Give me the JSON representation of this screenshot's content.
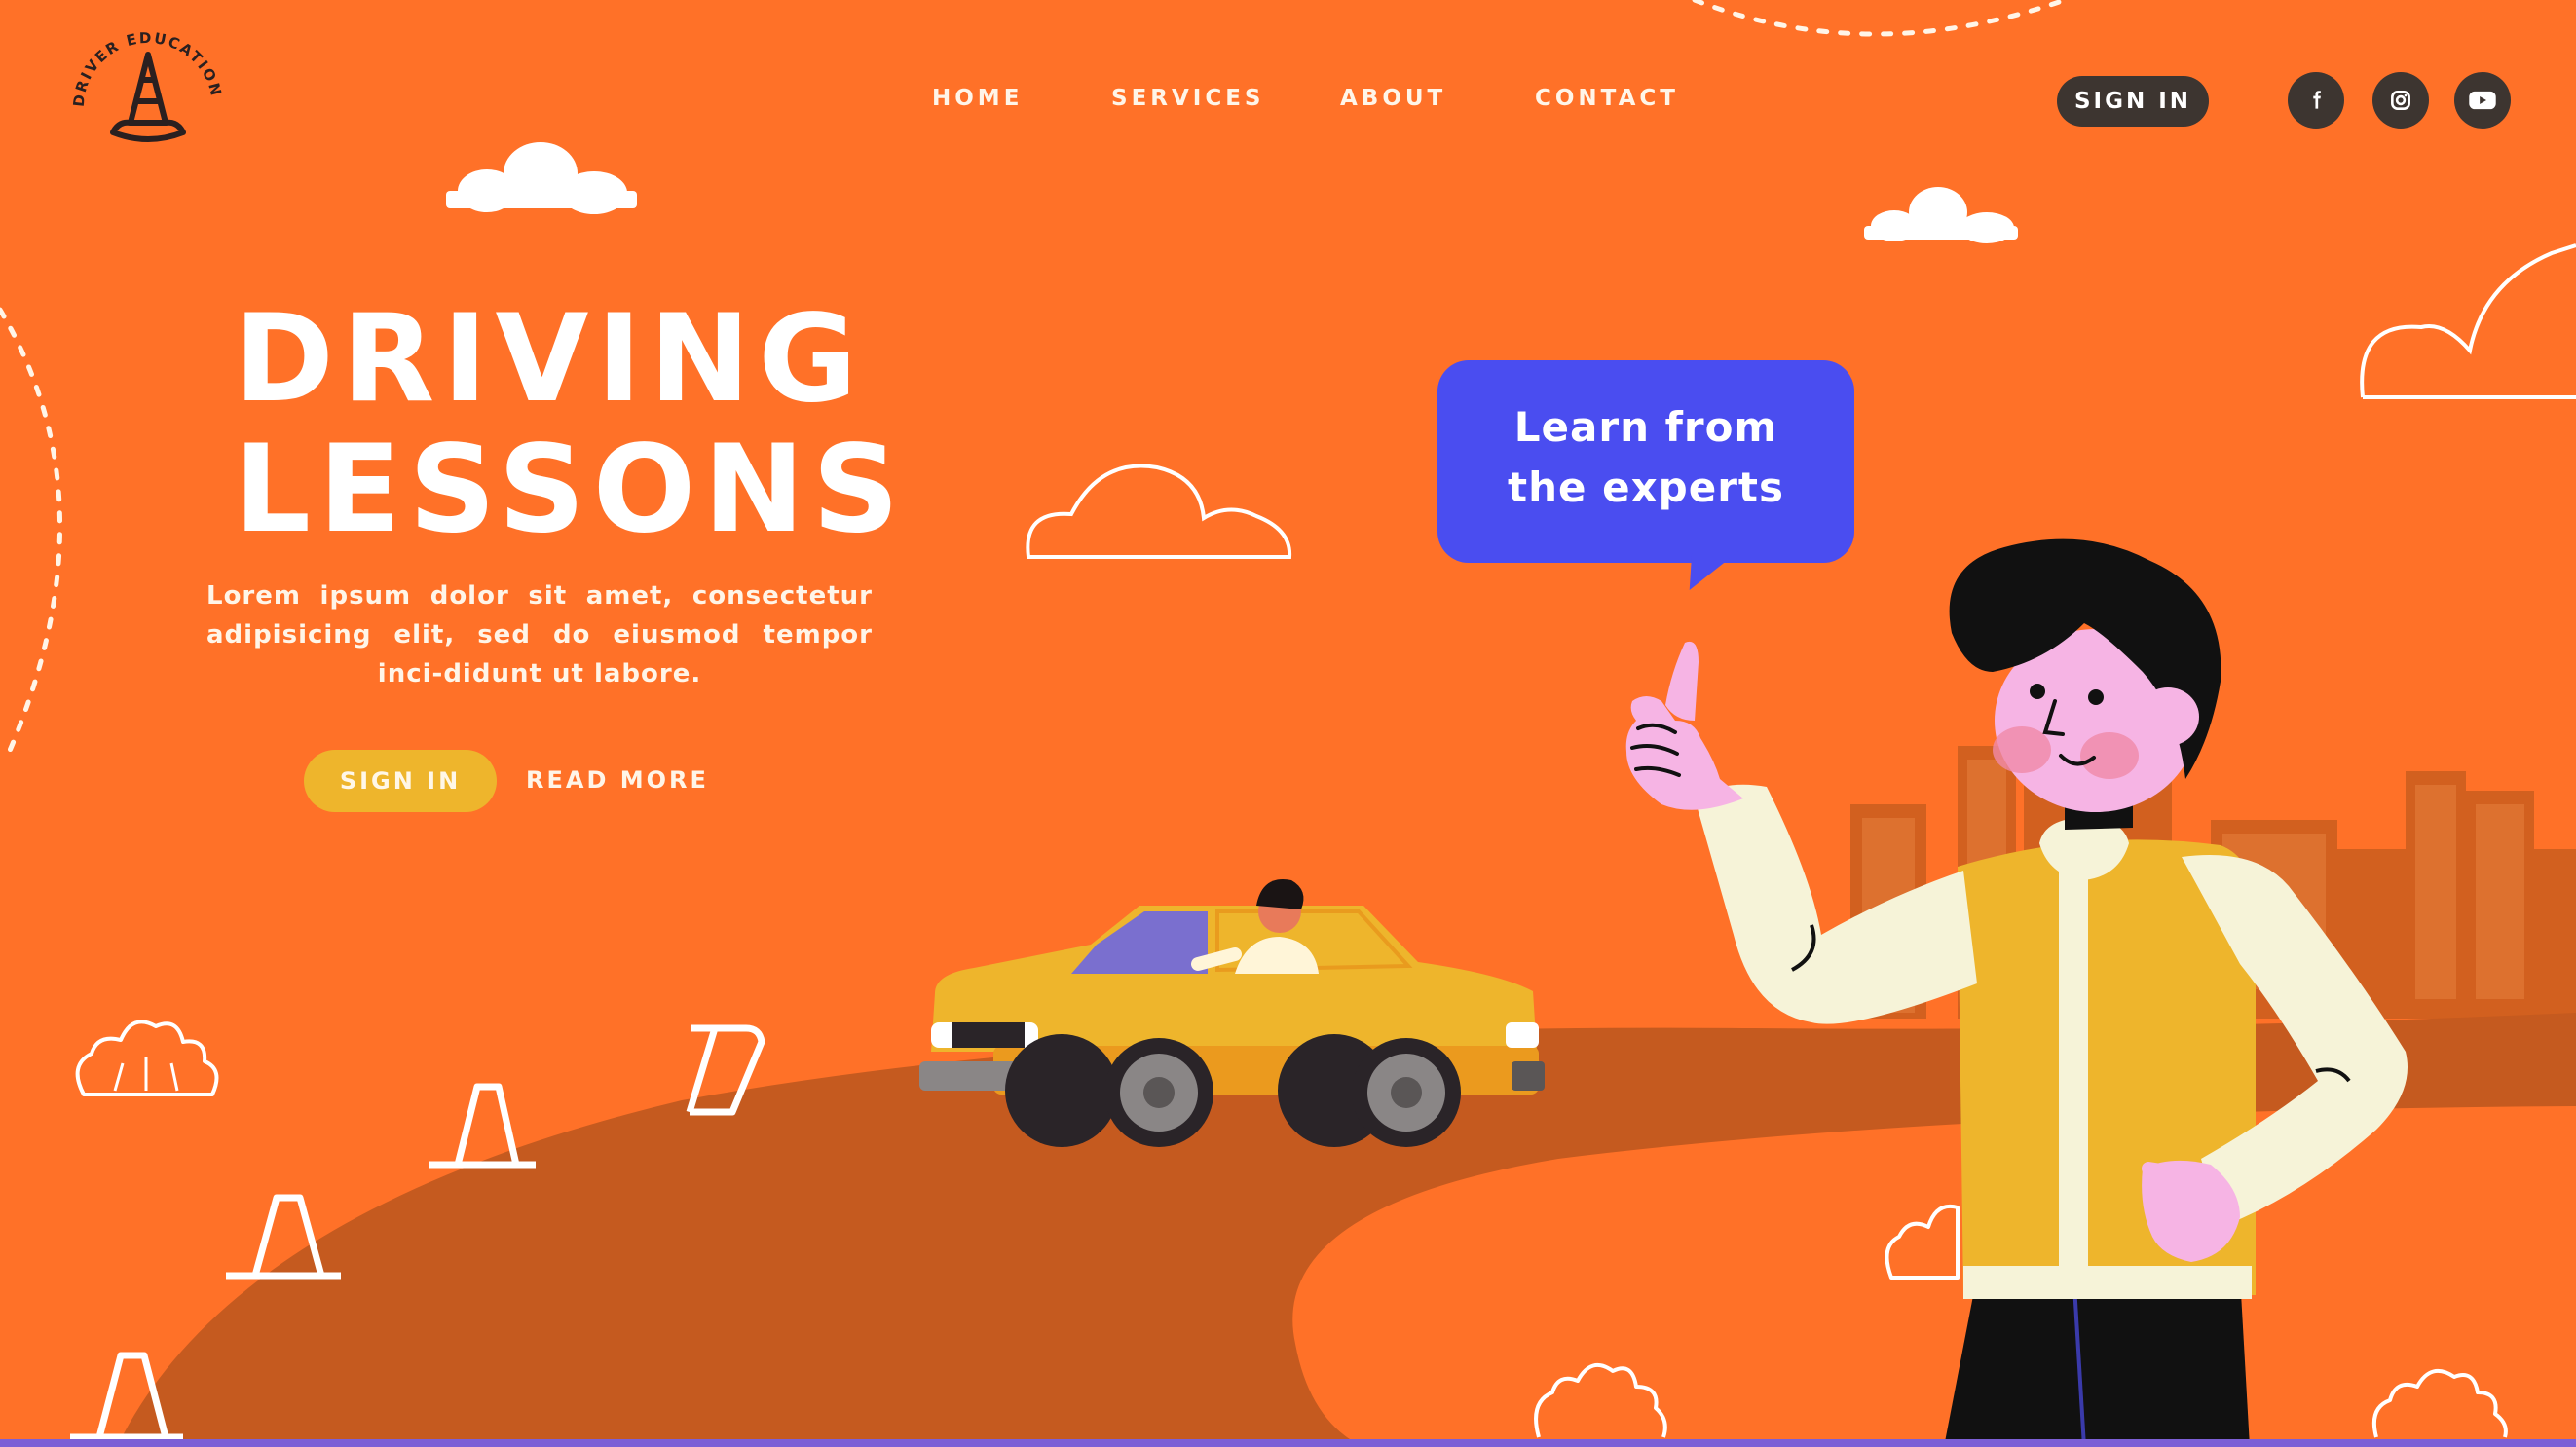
{
  "brand": {
    "logo_text": "DRIVER EDUCATION",
    "logo_icon": "traffic-cone-icon"
  },
  "nav": {
    "items": [
      {
        "label": "HOME"
      },
      {
        "label": "SERVICES"
      },
      {
        "label": "ABOUT"
      },
      {
        "label": "CONTACT"
      }
    ],
    "sign_in": "SIGN IN"
  },
  "social": [
    {
      "name": "facebook-icon"
    },
    {
      "name": "instagram-icon"
    },
    {
      "name": "youtube-icon"
    }
  ],
  "hero": {
    "title_line1": "DRIVING",
    "title_line2": "LESSONS",
    "body": "Lorem ipsum dolor sit amet, consectetur adipisicing elit, sed do eiusmod tempor inci-didunt ut labore.",
    "sign_in_button": "SIGN IN",
    "read_more": "READ MORE"
  },
  "speech_bubble": {
    "line1": "Learn from",
    "line2": "the experts"
  },
  "colors": {
    "background": "#ff7128",
    "road": "#c55a1f",
    "accent_yellow": "#eeb52c",
    "bubble_blue": "#4a4df0",
    "dark": "#3d3530"
  }
}
